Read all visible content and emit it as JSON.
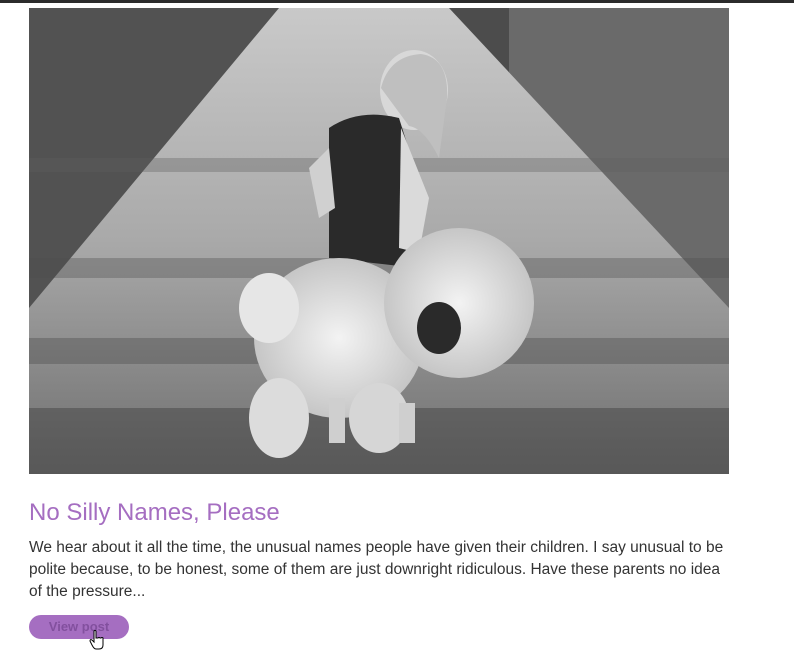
{
  "post": {
    "image_alt": "Black and white photo of a little girl walking down a dirt road carrying a large stuffed lion",
    "title": "No Silly Names, Please",
    "excerpt": "We hear about it all the time, the unusual names people have given their children. I say unusual to be polite because, to be honest, some of them are just downright ridiculous. Have these parents no idea of the pressure...",
    "button_label": "View post"
  },
  "colors": {
    "accent": "#a56ec1",
    "text": "#333333",
    "topbar": "#2b2b2b"
  }
}
